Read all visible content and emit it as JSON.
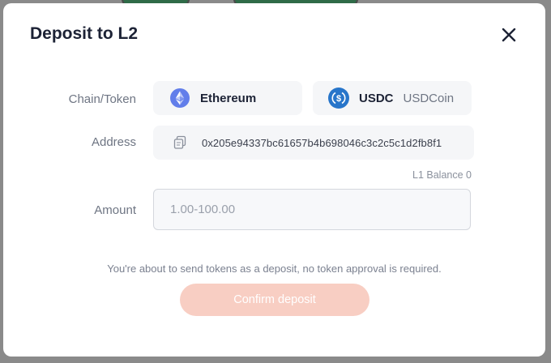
{
  "modal": {
    "title": "Deposit to L2"
  },
  "chain_token": {
    "label": "Chain/Token",
    "chain": {
      "name": "Ethereum",
      "icon": "ethereum-icon",
      "color": "#627eea"
    },
    "token": {
      "symbol": "USDC",
      "name": "USDCoin",
      "icon": "usdc-icon",
      "color": "#2775ca"
    }
  },
  "address": {
    "label": "Address",
    "icon": "copy-icon",
    "value": "0x205e94337bc61657b4b698046c3c2c5c1d2fb8f1"
  },
  "balance": {
    "text": "L1 Balance 0"
  },
  "amount": {
    "label": "Amount",
    "placeholder": "1.00-100.00",
    "value": ""
  },
  "notice": "You're about to send tokens as a deposit, no token approval is required.",
  "confirm_label": "Confirm deposit",
  "colors": {
    "confirm_button": "#f8cec3",
    "title": "#1c2235"
  }
}
